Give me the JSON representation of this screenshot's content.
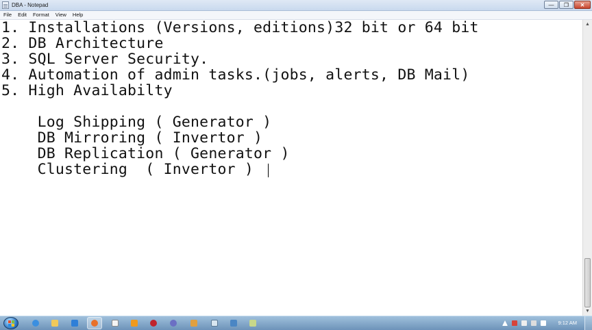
{
  "window": {
    "title": "DBA - Notepad",
    "minimize_glyph": "—",
    "maximize_glyph": "❐",
    "close_glyph": "✕"
  },
  "menu": [
    "File",
    "Edit",
    "Format",
    "View",
    "Help"
  ],
  "editor": {
    "lines": [
      "1. Installations (Versions, editions)32 bit or 64 bit",
      "2. DB Architecture",
      "3. SQL Server Security.",
      "4. Automation of admin tasks.(jobs, alerts, DB Mail)",
      "5. High Availabilty",
      "",
      "    Log Shipping ( Generator )",
      "    DB Mirroring ( Invertor )",
      "    DB Replication ( Generator )",
      "    Clustering  ( Invertor )"
    ]
  },
  "scrollbar": {
    "up_glyph": "▲",
    "down_glyph": "▼",
    "thumb_position": 0.85
  },
  "taskbar": {
    "clock": "9:12 AM",
    "pinned_icons": [
      "ie-icon",
      "folder-icon",
      "windows-explorer-icon",
      "firefox-icon",
      "notepad-icon",
      "media-player-icon",
      "ruby-icon",
      "chrome-icon",
      "settings-icon",
      "file-icon",
      "network-icon",
      "app-icon"
    ],
    "tray_icons": [
      "arrow-up-icon",
      "flag-icon",
      "network-tray-icon",
      "volume-icon",
      "power-icon"
    ]
  },
  "colors": {
    "titlebar": "#c9d9ee",
    "taskbar": "#6d93b9",
    "close_button": "#c7452d",
    "text": "#111111"
  }
}
